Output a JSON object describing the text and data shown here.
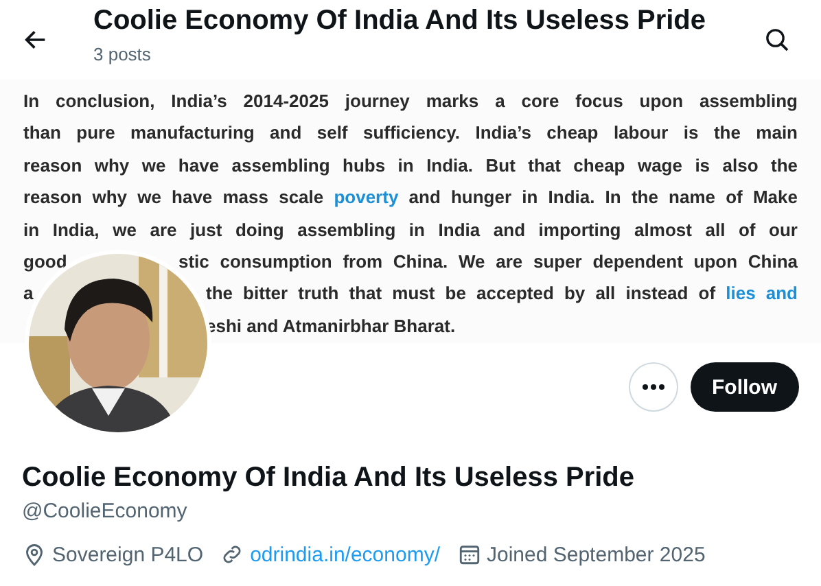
{
  "header": {
    "title": "Coolie Economy Of India And Its Useless Pride",
    "post_count": "3 posts"
  },
  "banner": {
    "kind": "document",
    "lines": [
      {
        "runs": [
          [
            {
              "text": "In conclusion, India’s 2014-2025 journey marks a core focus upon assembling",
              "link": false
            }
          ]
        ]
      },
      {
        "runs": [
          [
            {
              "text": "than pure manufacturing and self sufficiency. India’s cheap labour is the main",
              "link": false
            }
          ]
        ]
      },
      {
        "runs": [
          [
            {
              "text": "reason why we have assembling hubs in India. But that cheap wage is also the",
              "link": false
            }
          ]
        ]
      },
      {
        "runs": [
          [
            {
              "text": "reason why we have mass scale",
              "link": false
            },
            {
              "text": "poverty",
              "link": true
            },
            {
              "text": "and hunger in India. In the name of Make",
              "link": false
            }
          ]
        ]
      },
      {
        "runs": [
          [
            {
              "text": "in India, we are just doing assembling in India and importing almost all of our",
              "link": false
            }
          ]
        ]
      },
      {
        "runs": [
          [
            {
              "text": "good",
              "link": false
            }
          ],
          [
            {
              "text": "stic consumption from China. We are super dependent upon China",
              "link": false
            }
          ]
        ]
      },
      {
        "runs": [
          [
            {
              "text": "a",
              "link": false
            }
          ],
          [
            {
              "text": "the bitter truth that must be accepted by all instead of",
              "link": false
            },
            {
              "text": "lies and",
              "link": true
            }
          ]
        ]
      },
      {
        "runs": [
          [
            {
              "text": "eshi and Atmanirbhar Bharat.",
              "link": false
            }
          ]
        ]
      }
    ]
  },
  "follow_button": "Follow",
  "profile": {
    "name": "Coolie Economy Of India And Its Useless Pride",
    "handle": "@CoolieEconomy",
    "location": "Sovereign P4LO",
    "website": "odrindia.in/economy/",
    "joined": "Joined September 2025"
  }
}
